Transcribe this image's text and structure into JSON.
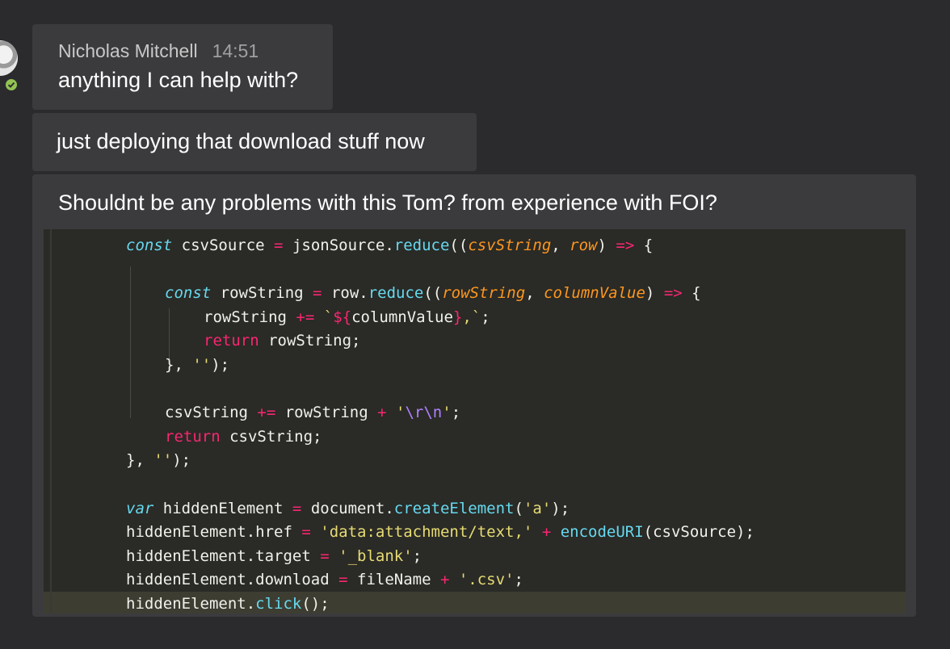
{
  "message": {
    "author": "Nicholas Mitchell",
    "time": "14:51",
    "lines": [
      "anything I can help with?",
      "just deploying that download stuff now",
      "Shouldnt be any problems with this Tom? from experience with FOI?"
    ]
  },
  "presence": {
    "status": "available",
    "color": "#92c353"
  },
  "code": {
    "lines": [
      [
        [
          "kw",
          "const"
        ],
        [
          "t",
          " csvSource "
        ],
        [
          "op",
          "="
        ],
        [
          "t",
          " jsonSource."
        ],
        [
          "fn",
          "reduce"
        ],
        [
          "t",
          "(("
        ],
        [
          "par",
          "csvString"
        ],
        [
          "t",
          ", "
        ],
        [
          "par",
          "row"
        ],
        [
          "t",
          ") "
        ],
        [
          "op",
          "=>"
        ],
        [
          "t",
          " {"
        ]
      ],
      [],
      [
        [
          "kw",
          "const"
        ],
        [
          "t",
          " rowString "
        ],
        [
          "op",
          "="
        ],
        [
          "t",
          " row."
        ],
        [
          "fn",
          "reduce"
        ],
        [
          "t",
          "(("
        ],
        [
          "par",
          "rowString"
        ],
        [
          "t",
          ", "
        ],
        [
          "par",
          "columnValue"
        ],
        [
          "t",
          ") "
        ],
        [
          "op",
          "=>"
        ],
        [
          "t",
          " {"
        ]
      ],
      [
        [
          "t",
          "rowString "
        ],
        [
          "op",
          "+="
        ],
        [
          "t",
          " "
        ],
        [
          "str",
          "`"
        ],
        [
          "op",
          "${"
        ],
        [
          "t",
          "columnValue"
        ],
        [
          "op",
          "}"
        ],
        [
          "str",
          ",`"
        ],
        [
          "t",
          ";"
        ]
      ],
      [
        [
          "ret",
          "return"
        ],
        [
          "t",
          " rowString;"
        ]
      ],
      [
        [
          "t",
          "}, "
        ],
        [
          "str",
          "''"
        ],
        [
          "t",
          ");"
        ]
      ],
      [],
      [
        [
          "t",
          "csvString "
        ],
        [
          "op",
          "+="
        ],
        [
          "t",
          " rowString "
        ],
        [
          "op",
          "+"
        ],
        [
          "t",
          " "
        ],
        [
          "str",
          "'"
        ],
        [
          "esc",
          "\\r\\n"
        ],
        [
          "str",
          "'"
        ],
        [
          "t",
          ";"
        ]
      ],
      [
        [
          "ret",
          "return"
        ],
        [
          "t",
          " csvString;"
        ]
      ],
      [
        [
          "t",
          "}, "
        ],
        [
          "str",
          "''"
        ],
        [
          "t",
          ");"
        ]
      ],
      [],
      [
        [
          "kw",
          "var"
        ],
        [
          "t",
          " hiddenElement "
        ],
        [
          "op",
          "="
        ],
        [
          "t",
          " document."
        ],
        [
          "fn",
          "createElement"
        ],
        [
          "t",
          "("
        ],
        [
          "str",
          "'a'"
        ],
        [
          "t",
          ");"
        ]
      ],
      [
        [
          "t",
          "hiddenElement.href "
        ],
        [
          "op",
          "="
        ],
        [
          "t",
          " "
        ],
        [
          "str",
          "'data:attachment/text,'"
        ],
        [
          "t",
          " "
        ],
        [
          "op",
          "+"
        ],
        [
          "t",
          " "
        ],
        [
          "fn",
          "encodeURI"
        ],
        [
          "t",
          "(csvSource);"
        ]
      ],
      [
        [
          "t",
          "hiddenElement.target "
        ],
        [
          "op",
          "="
        ],
        [
          "t",
          " "
        ],
        [
          "str",
          "'_blank'"
        ],
        [
          "t",
          ";"
        ]
      ],
      [
        [
          "t",
          "hiddenElement.download "
        ],
        [
          "op",
          "="
        ],
        [
          "t",
          " fileName "
        ],
        [
          "op",
          "+"
        ],
        [
          "t",
          " "
        ],
        [
          "str",
          "'.csv'"
        ],
        [
          "t",
          ";"
        ]
      ],
      [
        [
          "t",
          "hiddenElement."
        ],
        [
          "fn",
          "click"
        ],
        [
          "t",
          "();"
        ]
      ]
    ]
  }
}
